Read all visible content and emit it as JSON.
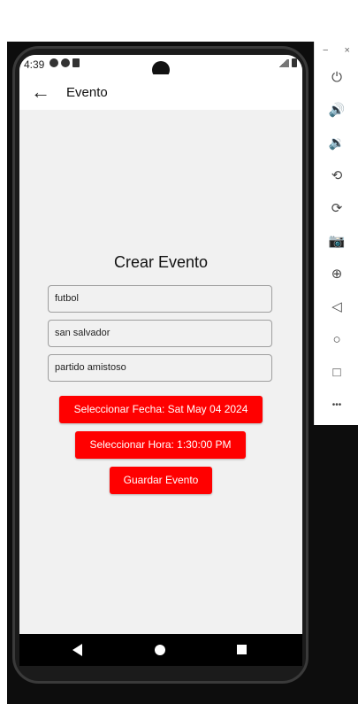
{
  "status_bar": {
    "time": "4:39"
  },
  "app_bar": {
    "back_icon": "←",
    "title": "Evento"
  },
  "form": {
    "title": "Crear Evento",
    "fields": [
      {
        "value": "futbol"
      },
      {
        "value": "san salvador"
      },
      {
        "value": "partido amistoso"
      }
    ],
    "date_button": "Seleccionar Fecha: Sat May 04 2024",
    "time_button": "Seleccionar Hora: 1:30:00 PM",
    "save_button": "Guardar Evento"
  },
  "colors": {
    "accent": "#ff0000",
    "screen_bg": "#f1f1f1"
  },
  "emulator_panel": {
    "minimize": "−",
    "close": "×",
    "tools": [
      {
        "icon": "power-icon",
        "glyph": "⏻"
      },
      {
        "icon": "volume-up-icon",
        "glyph": "🔊"
      },
      {
        "icon": "volume-down-icon",
        "glyph": "🔉"
      },
      {
        "icon": "rotate-left-icon",
        "glyph": "⟲"
      },
      {
        "icon": "rotate-right-icon",
        "glyph": "⟳"
      },
      {
        "icon": "camera-icon",
        "glyph": "📷"
      },
      {
        "icon": "zoom-icon",
        "glyph": "⊕"
      },
      {
        "icon": "back-icon",
        "glyph": "◁"
      },
      {
        "icon": "home-icon",
        "glyph": "○"
      },
      {
        "icon": "overview-icon",
        "glyph": "□"
      },
      {
        "icon": "more-icon",
        "glyph": "•••"
      }
    ]
  }
}
